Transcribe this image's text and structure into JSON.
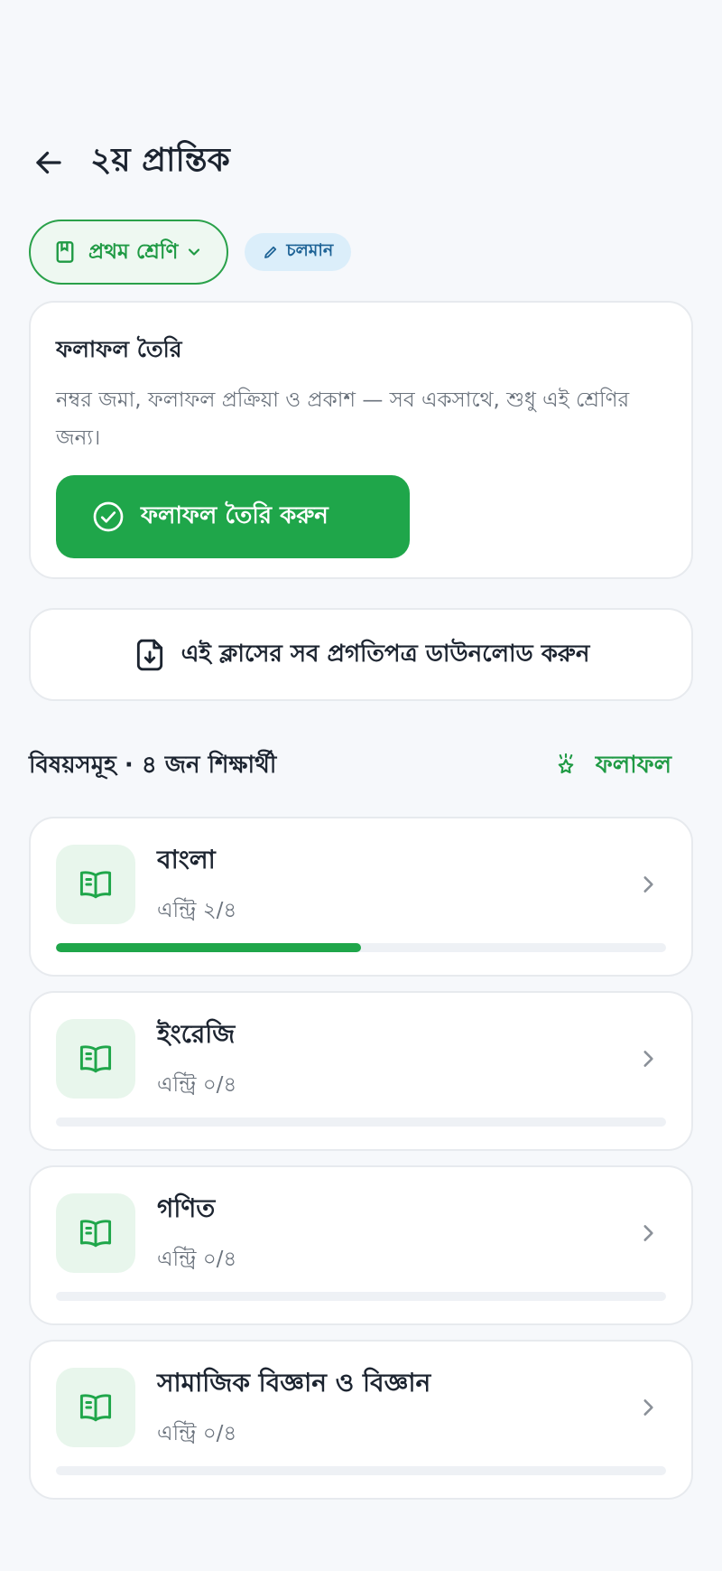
{
  "header": {
    "title": "২য় প্রান্তিক"
  },
  "chips": {
    "class_label": "প্রথম শ্রেণি",
    "status_label": "চলমান"
  },
  "result_card": {
    "title": "ফলাফল তৈরি",
    "description": "নম্বর জমা, ফলাফল প্রক্রিয়া ও প্রকাশ — সব একসাথে, শুধু এই শ্রেণির জন্য।",
    "button_label": "ফলাফল তৈরি করুন"
  },
  "download": {
    "label": "এই ক্লাসের সব প্রগতিপত্র ডাউনলোড করুন"
  },
  "section": {
    "count_label": "বিষয়সমূহ · ৪ জন শিক্ষার্থী",
    "results_link": "ফলাফল"
  },
  "subjects": [
    {
      "name": "বাংলা",
      "entry": "এন্ট্রি ২/৪",
      "progress": 0.5
    },
    {
      "name": "ইংরেজি",
      "entry": "এন্ট্রি ০/৪",
      "progress": 0
    },
    {
      "name": "গণিত",
      "entry": "এন্ট্রি ০/৪",
      "progress": 0
    },
    {
      "name": "সামাজিক বিজ্ঞান ও বিজ্ঞান",
      "entry": "এন্ট্রি ০/৪",
      "progress": 0
    }
  ],
  "colors": {
    "primary": "#1fa64a",
    "status_bg": "#dbeefa",
    "status_text": "#1e6396"
  }
}
